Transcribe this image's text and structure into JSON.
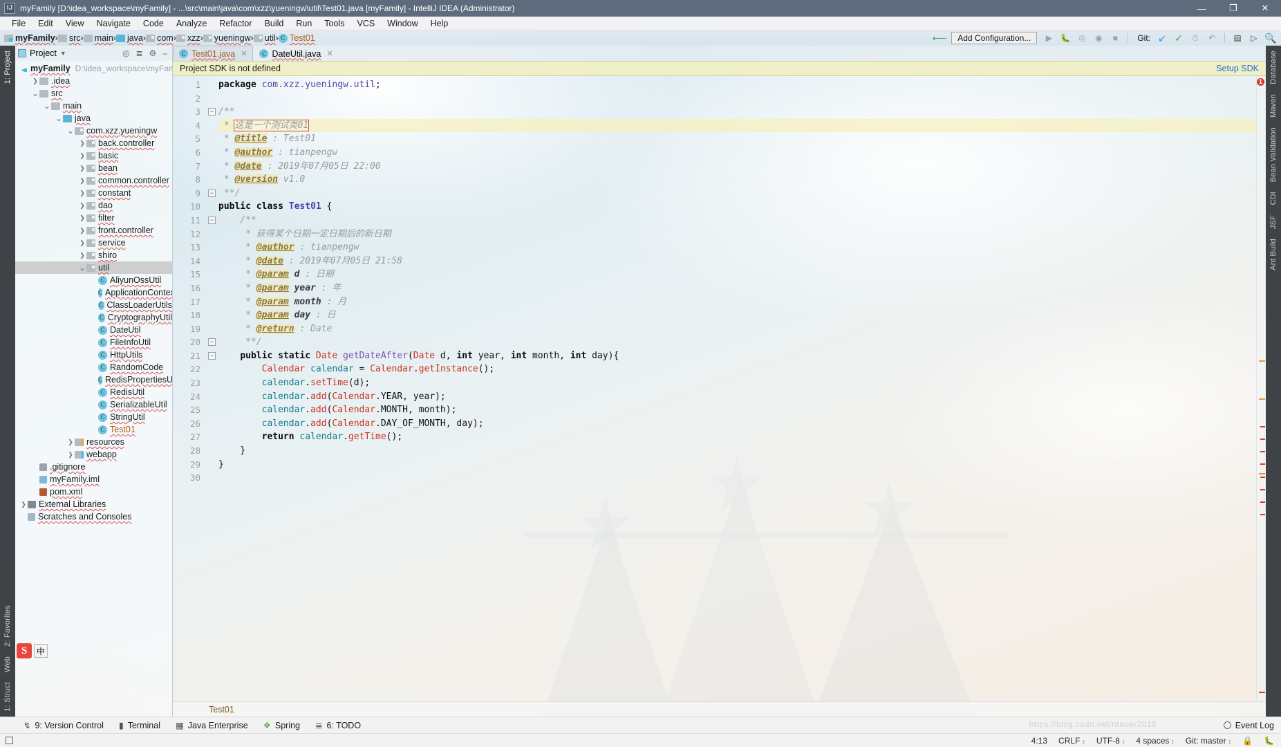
{
  "window": {
    "title": "myFamily [D:\\idea_workspace\\myFamily] - ...\\src\\main\\java\\com\\xzz\\yueningw\\util\\Test01.java [myFamily] - IntelliJ IDEA (Administrator)",
    "app_icon": "IJ",
    "minimize": "—",
    "maximize": "❐",
    "close": "✕"
  },
  "menubar": [
    "File",
    "Edit",
    "View",
    "Navigate",
    "Code",
    "Analyze",
    "Refactor",
    "Build",
    "Run",
    "Tools",
    "VCS",
    "Window",
    "Help"
  ],
  "navbar": {
    "breadcrumbs": [
      {
        "label": "myFamily",
        "icon": "module-folder-icon"
      },
      {
        "label": "src",
        "icon": "folder-icon"
      },
      {
        "label": "main",
        "icon": "folder-icon"
      },
      {
        "label": "java",
        "icon": "source-folder-icon"
      },
      {
        "label": "com",
        "icon": "package-icon"
      },
      {
        "label": "xzz",
        "icon": "package-icon"
      },
      {
        "label": "yueningw",
        "icon": "package-icon"
      },
      {
        "label": "util",
        "icon": "package-icon"
      },
      {
        "label": "Test01",
        "icon": "class-icon"
      }
    ],
    "separator": "›",
    "add_configuration": "Add Configuration...",
    "git_label": "Git:",
    "run_icon": "run-icon",
    "debug_icon": "debug-icon",
    "run_coverage_icon": "run-with-coverage-icon",
    "profile_icon": "profile-icon",
    "stop_icon": "stop-icon",
    "update_project_icon": "update-project-icon",
    "commit_icon": "commit-icon",
    "history_icon": "history-icon",
    "rollback_icon": "rollback-icon",
    "project_structure_icon": "project-structure-icon",
    "terminal_icon": "terminal-icon",
    "search_everywhere_icon": "search-icon",
    "back_arrow_icon": "back-arrow-icon"
  },
  "left_strip": {
    "top": [
      "1: Project"
    ],
    "bottom": [
      "2: Favorites",
      "1: Struct"
    ],
    "web": "Web"
  },
  "right_strip": [
    "Database",
    "Maven",
    "Bean Validation",
    "CDI",
    "JSF",
    "Ant Build"
  ],
  "project_pane": {
    "title": "Project",
    "dropdown_icon": "chevron-down-icon",
    "actions": [
      "locate-icon",
      "collapse-all-icon",
      "settings-icon",
      "hide-icon"
    ],
    "tree": [
      {
        "depth": 0,
        "label": "myFamily",
        "path": "D:\\idea_workspace\\myFamil",
        "icon": "module-icon",
        "arrow": "⌄",
        "bold": true
      },
      {
        "depth": 1,
        "label": ".idea",
        "icon": "folder-icon",
        "arrow": "›"
      },
      {
        "depth": 1,
        "label": "src",
        "icon": "folder-icon",
        "arrow": "⌄"
      },
      {
        "depth": 2,
        "label": "main",
        "icon": "folder-icon",
        "arrow": "⌄"
      },
      {
        "depth": 3,
        "label": "java",
        "icon": "source-folder-icon",
        "arrow": "⌄"
      },
      {
        "depth": 4,
        "label": "com.xzz.yueningw",
        "icon": "package-icon",
        "arrow": "⌄"
      },
      {
        "depth": 5,
        "label": "back.controller",
        "icon": "package-icon",
        "arrow": "›"
      },
      {
        "depth": 5,
        "label": "basic",
        "icon": "package-icon",
        "arrow": "›"
      },
      {
        "depth": 5,
        "label": "bean",
        "icon": "package-icon",
        "arrow": "›"
      },
      {
        "depth": 5,
        "label": "common.controller",
        "icon": "package-icon",
        "arrow": "›"
      },
      {
        "depth": 5,
        "label": "constant",
        "icon": "package-icon",
        "arrow": "›"
      },
      {
        "depth": 5,
        "label": "dao",
        "icon": "package-icon",
        "arrow": "›"
      },
      {
        "depth": 5,
        "label": "filter",
        "icon": "package-icon",
        "arrow": "›"
      },
      {
        "depth": 5,
        "label": "front.controller",
        "icon": "package-icon",
        "arrow": "›"
      },
      {
        "depth": 5,
        "label": "service",
        "icon": "package-icon",
        "arrow": "›"
      },
      {
        "depth": 5,
        "label": "shiro",
        "icon": "package-icon",
        "arrow": "›"
      },
      {
        "depth": 5,
        "label": "util",
        "icon": "package-icon",
        "arrow": "⌄",
        "selected": true
      },
      {
        "depth": 6,
        "label": "AliyunOssUtil",
        "icon": "class-icon"
      },
      {
        "depth": 6,
        "label": "ApplicationContext",
        "icon": "class-icon"
      },
      {
        "depth": 6,
        "label": "ClassLoaderUtils",
        "icon": "class-icon"
      },
      {
        "depth": 6,
        "label": "CryptographyUtil",
        "icon": "class-icon"
      },
      {
        "depth": 6,
        "label": "DateUtil",
        "icon": "class-icon"
      },
      {
        "depth": 6,
        "label": "FileInfoUtil",
        "icon": "class-icon"
      },
      {
        "depth": 6,
        "label": "HttpUtils",
        "icon": "class-icon"
      },
      {
        "depth": 6,
        "label": "RandomCode",
        "icon": "class-icon"
      },
      {
        "depth": 6,
        "label": "RedisPropertiesUti",
        "icon": "class-icon"
      },
      {
        "depth": 6,
        "label": "RedisUtil",
        "icon": "class-icon"
      },
      {
        "depth": 6,
        "label": "SerializableUtil",
        "icon": "class-icon"
      },
      {
        "depth": 6,
        "label": "StringUtil",
        "icon": "class-icon"
      },
      {
        "depth": 6,
        "label": "Test01",
        "icon": "class-icon",
        "orange": true
      },
      {
        "depth": 4,
        "label": "resources",
        "icon": "resources-folder-icon",
        "arrow": "›"
      },
      {
        "depth": 4,
        "label": "webapp",
        "icon": "webapp-folder-icon",
        "arrow": "›"
      },
      {
        "depth": 1,
        "label": ".gitignore",
        "icon": "gitignore-icon"
      },
      {
        "depth": 1,
        "label": "myFamily.iml",
        "icon": "iml-icon"
      },
      {
        "depth": 1,
        "label": "pom.xml",
        "icon": "maven-icon"
      },
      {
        "depth": 0,
        "label": "External Libraries",
        "icon": "libraries-icon",
        "arrow": "›"
      },
      {
        "depth": 0,
        "label": "Scratches and Consoles",
        "icon": "scratches-icon"
      }
    ]
  },
  "editor": {
    "tabs": [
      {
        "label": "Test01.java",
        "icon": "class-icon",
        "active": true,
        "close": "✕"
      },
      {
        "label": "DateUtil.java",
        "icon": "class-icon",
        "active": false,
        "close": "✕"
      }
    ],
    "notification": {
      "text": "Project SDK is not defined",
      "action": "Setup SDK"
    },
    "breadcrumb": "Test01",
    "error_count": "1",
    "first_line": 1,
    "last_line": 30,
    "highlighted_line": 4,
    "selection_text": "这是一个测试类01",
    "fold_markers": [
      3,
      9,
      11,
      20,
      21
    ],
    "lines": [
      {
        "n": 1,
        "text": "package com.xzz.yueningw.util;"
      },
      {
        "n": 2,
        "text": ""
      },
      {
        "n": 3,
        "text": "/**"
      },
      {
        "n": 4,
        "text": " * 这是一个测试类01"
      },
      {
        "n": 5,
        "text": " * @title : Test01"
      },
      {
        "n": 6,
        "text": " * @author : tianpengw"
      },
      {
        "n": 7,
        "text": " * @date : 2019年07月05日 22:00"
      },
      {
        "n": 8,
        "text": " * @version v1.0"
      },
      {
        "n": 9,
        "text": " **/"
      },
      {
        "n": 10,
        "text": "public class Test01 {"
      },
      {
        "n": 11,
        "text": "    /**"
      },
      {
        "n": 12,
        "text": "     * 获得某个日期一定日期后的新日期"
      },
      {
        "n": 13,
        "text": "     * @author : tianpengw"
      },
      {
        "n": 14,
        "text": "     * @date : 2019年07月05日 21:58"
      },
      {
        "n": 15,
        "text": "     * @param d : 日期"
      },
      {
        "n": 16,
        "text": "     * @param year : 年"
      },
      {
        "n": 17,
        "text": "     * @param month : 月"
      },
      {
        "n": 18,
        "text": "     * @param day : 日"
      },
      {
        "n": 19,
        "text": "     * @return : Date"
      },
      {
        "n": 20,
        "text": "     **/"
      },
      {
        "n": 21,
        "text": "    public static Date getDateAfter(Date d, int year, int month, int day){"
      },
      {
        "n": 22,
        "text": "        Calendar calendar = Calendar.getInstance();"
      },
      {
        "n": 23,
        "text": "        calendar.setTime(d);"
      },
      {
        "n": 24,
        "text": "        calendar.add(Calendar.YEAR, year);"
      },
      {
        "n": 25,
        "text": "        calendar.add(Calendar.MONTH, month);"
      },
      {
        "n": 26,
        "text": "        calendar.add(Calendar.DAY_OF_MONTH, day);"
      },
      {
        "n": 27,
        "text": "        return calendar.getTime();"
      },
      {
        "n": 28,
        "text": "    }"
      },
      {
        "n": 29,
        "text": "}"
      },
      {
        "n": 30,
        "text": ""
      }
    ]
  },
  "bottom_bar": {
    "items": [
      {
        "label": "9: Version Control",
        "icon": "version-control-icon",
        "mnemonic": "9"
      },
      {
        "label": "Terminal",
        "icon": "terminal-icon"
      },
      {
        "label": "Java Enterprise",
        "icon": "java-enterprise-icon"
      },
      {
        "label": "Spring",
        "icon": "spring-icon"
      },
      {
        "label": "6: TODO",
        "icon": "todo-icon",
        "mnemonic": "6"
      }
    ],
    "event_log": "Event Log",
    "event_log_icon": "event-log-icon"
  },
  "status_bar": {
    "caret": "4:13",
    "line_separator": "CRLF",
    "encoding": "UTF-8",
    "indent": "4 spaces",
    "branch": "Git: master",
    "lock_icon": "lock-icon",
    "inspections_icon": "inspections-icon"
  },
  "watermark": "https://blog.csdn.net/ntaoer2018",
  "ime": {
    "logo": "S",
    "mode": "中"
  },
  "colors": {
    "titlebar": "#5d6b7d",
    "accent_blue": "#2470c4",
    "notification_bg": "#f0f0c8",
    "selection_outline": "#d64540",
    "error_red": "#d63b30",
    "commit_green": "#4aa84a",
    "update_blue": "#2f9fdc",
    "orange_file": "#b35a12",
    "toolwindow_strip": "#3f4347"
  }
}
